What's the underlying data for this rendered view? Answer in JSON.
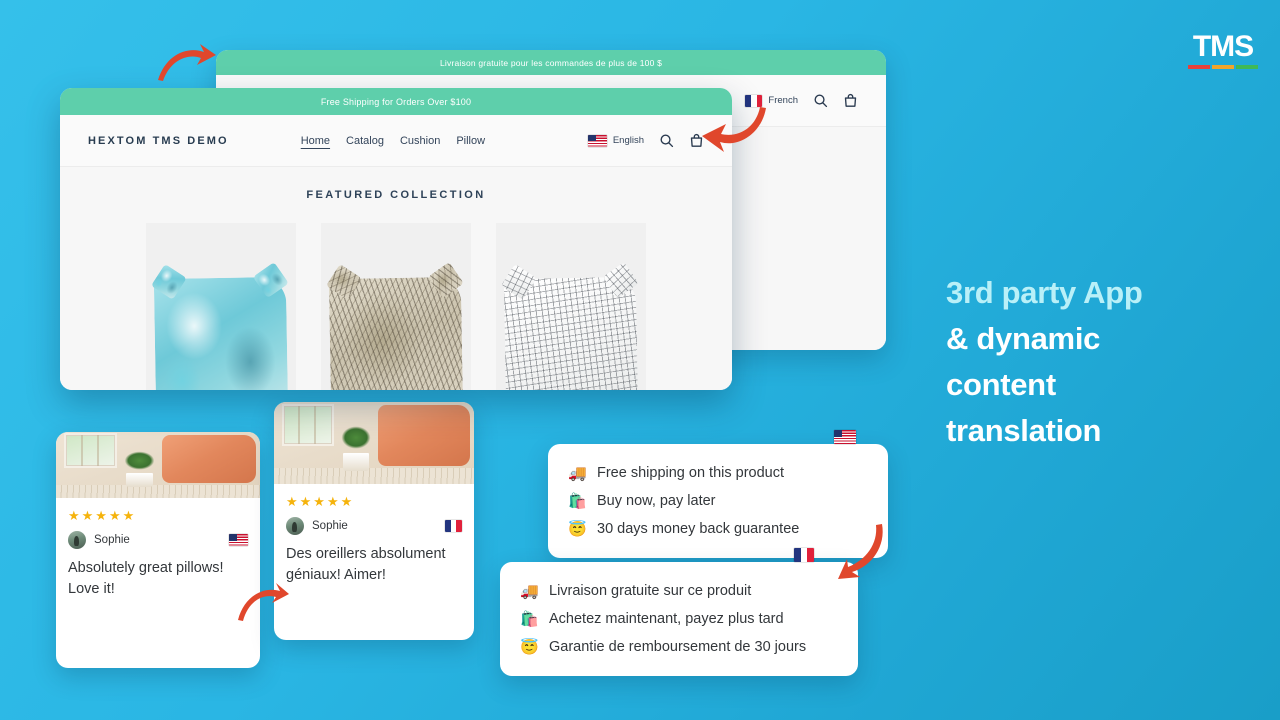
{
  "brand": {
    "logo_text": "TMS",
    "logo_bar_colors": [
      "#e8413a",
      "#f2a52a",
      "#3fb956"
    ]
  },
  "headline": {
    "accent_line": "3rd party App",
    "rest_lines": [
      "& dynamic",
      "content",
      "translation"
    ],
    "accent_color": "#b9f0f8",
    "text_color": "#ffffff"
  },
  "background": {
    "gradient_from": "#35c0ea",
    "gradient_to": "#199ec8"
  },
  "browser_back": {
    "promo_text": "Livraison gratuite pour les commandes de plus de 100 $",
    "promo_bg": "#5ecfab",
    "language": "French",
    "language_flag": "flag-fr",
    "search_icon": "search-icon",
    "cart_icon": "shopping-bag-icon"
  },
  "browser_front": {
    "promo_text": "Free Shipping for Orders Over $100",
    "promo_bg": "#5ecfab",
    "shop_name": "HEXTOM TMS DEMO",
    "nav_links": [
      {
        "label": "Home",
        "active": true
      },
      {
        "label": "Catalog",
        "active": false
      },
      {
        "label": "Cushion",
        "active": false
      },
      {
        "label": "Pillow",
        "active": false
      }
    ],
    "language": "English",
    "language_flag": "flag-us",
    "search_icon": "search-icon",
    "cart_icon": "shopping-bag-icon",
    "section_title": "FEATURED COLLECTION",
    "products": [
      {
        "name": "teal-watercolor-pillow"
      },
      {
        "name": "botanical-print-pillow"
      },
      {
        "name": "grid-pattern-pillow"
      }
    ]
  },
  "review_en": {
    "stars": "★★★★★",
    "rating": 5,
    "reviewer": "Sophie",
    "flag": "flag-us",
    "text": "Absolutely great pillows! Love it!"
  },
  "review_fr": {
    "stars": "★★★★★",
    "rating": 5,
    "reviewer": "Sophie",
    "flag": "flag-fr",
    "text": "Des oreillers absolument géniaux! Aimer!"
  },
  "benefit_en": {
    "flag": "flag-us",
    "rows": [
      {
        "emoji": "🚚",
        "icon": "delivery-truck-icon",
        "text": "Free shipping on this product"
      },
      {
        "emoji": "🛍️",
        "icon": "shopping-bags-icon",
        "text": "Buy now, pay later"
      },
      {
        "emoji": "😇",
        "icon": "smiling-angel-icon",
        "text": "30 days money back guarantee"
      }
    ]
  },
  "benefit_fr": {
    "flag": "flag-fr",
    "rows": [
      {
        "emoji": "🚚",
        "icon": "delivery-truck-icon",
        "text": "Livraison gratuite sur ce produit"
      },
      {
        "emoji": "🛍️",
        "icon": "shopping-bags-icon",
        "text": "Achetez maintenant, payez plus tard"
      },
      {
        "emoji": "😇",
        "icon": "smiling-angel-icon",
        "text": "Garantie de remboursement de 30 jours"
      }
    ]
  },
  "arrows": {
    "color": "#e0472c",
    "items": [
      {
        "name": "arrow-to-french-banner",
        "direction": "right"
      },
      {
        "name": "arrow-to-english-cart",
        "direction": "left"
      },
      {
        "name": "arrow-to-french-review",
        "direction": "right-up"
      },
      {
        "name": "arrow-to-french-benefits",
        "direction": "down"
      }
    ]
  }
}
